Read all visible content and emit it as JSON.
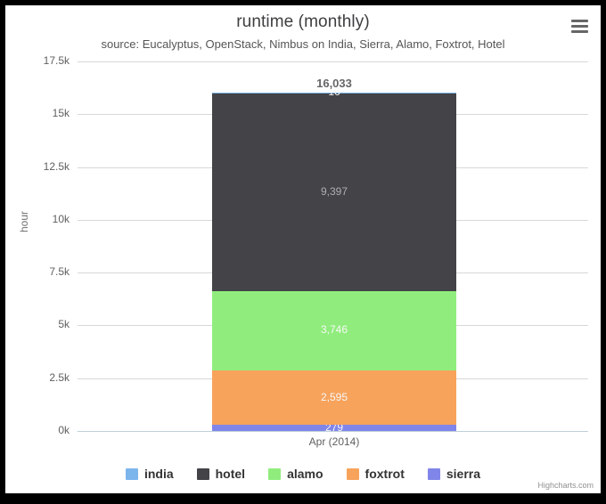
{
  "chart": {
    "title": "runtime (monthly)",
    "subtitle": "source: Eucalyptus, OpenStack, Nimbus on India, Sierra, Alamo, Foxtrot, Hotel",
    "credits": "Highcharts.com",
    "export_icon": "hamburger-menu-icon",
    "background": "#ffffff",
    "frame_color": "#000000"
  },
  "chart_data": {
    "type": "bar",
    "stacked": true,
    "title": "runtime (monthly)",
    "subtitle": "source: Eucalyptus, OpenStack, Nimbus on India, Sierra, Alamo, Foxtrot, Hotel",
    "xlabel": "",
    "ylabel": "hour",
    "categories": [
      "Apr (2014)"
    ],
    "ylim": [
      0,
      17500
    ],
    "ytick_labels": [
      "0k",
      "2.5k",
      "5k",
      "7.5k",
      "10k",
      "12.5k",
      "15k",
      "17.5k"
    ],
    "ytick_values": [
      0,
      2500,
      5000,
      7500,
      10000,
      12500,
      15000,
      17500
    ],
    "grid": true,
    "legend_position": "bottom",
    "stack_total": 16033,
    "stack_total_label": "16,033",
    "series": [
      {
        "name": "india",
        "color": "#7CB5EC",
        "values": [
          16
        ],
        "label": "16"
      },
      {
        "name": "hotel",
        "color": "#434348",
        "values": [
          9397
        ],
        "label": "9,397"
      },
      {
        "name": "alamo",
        "color": "#90ED7D",
        "values": [
          3746
        ],
        "label": "3,746"
      },
      {
        "name": "foxtrot",
        "color": "#F7A35C",
        "values": [
          2595
        ],
        "label": "2,595"
      },
      {
        "name": "sierra",
        "color": "#8085E9",
        "values": [
          279
        ],
        "label": "279"
      }
    ]
  },
  "yaxis": {
    "title": "hour",
    "ticks": [
      {
        "label": "17.5k"
      },
      {
        "label": "15k"
      },
      {
        "label": "12.5k"
      },
      {
        "label": "10k"
      },
      {
        "label": "7.5k"
      },
      {
        "label": "5k"
      },
      {
        "label": "2.5k"
      },
      {
        "label": "0k"
      }
    ]
  },
  "xaxis": {
    "categories": [
      {
        "label": "Apr (2014)"
      }
    ]
  },
  "legend": {
    "items": [
      {
        "label": "india",
        "color": "#7CB5EC"
      },
      {
        "label": "hotel",
        "color": "#434348"
      },
      {
        "label": "alamo",
        "color": "#90ED7D"
      },
      {
        "label": "foxtrot",
        "color": "#F7A35C"
      },
      {
        "label": "sierra",
        "color": "#8085E9"
      }
    ]
  }
}
